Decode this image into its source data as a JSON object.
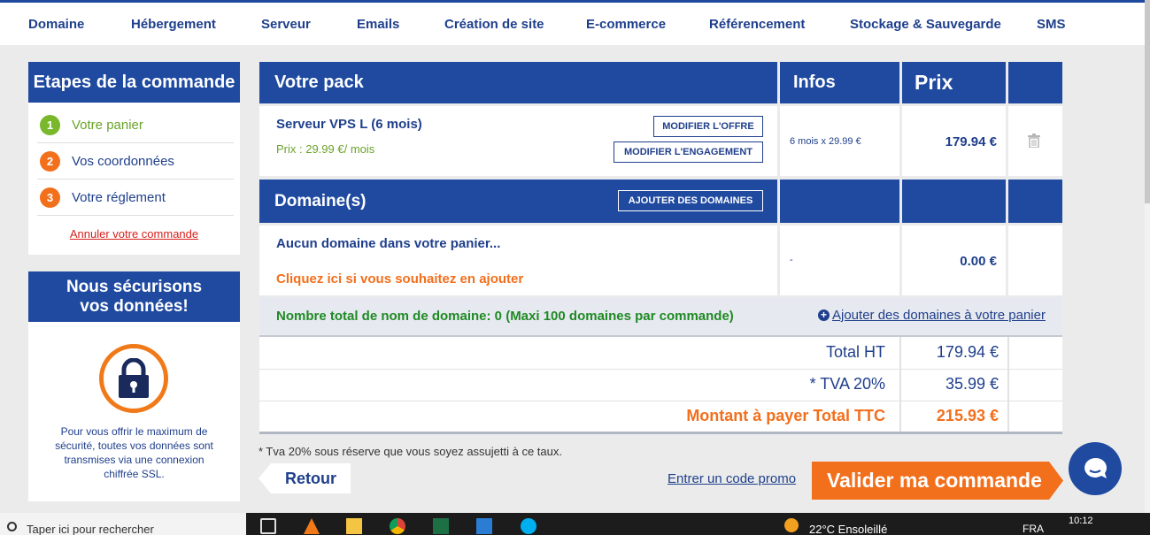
{
  "nav": [
    "Domaine",
    "Hébergement",
    "Serveur",
    "Emails",
    "Création de site",
    "E-commerce",
    "Référencement",
    "Stockage & Sauvegarde",
    "SMS"
  ],
  "steps": {
    "title": "Etapes de la commande",
    "items": [
      {
        "num": "1",
        "label": "Votre panier",
        "state": "active"
      },
      {
        "num": "2",
        "label": "Vos coordonnées",
        "state": "pending"
      },
      {
        "num": "3",
        "label": "Votre réglement",
        "state": "pending"
      }
    ],
    "cancel": "Annuler votre commande"
  },
  "secure": {
    "title_line1": "Nous sécurisons",
    "title_line2": "vos données!",
    "text": "Pour vous offrir le maximum de sécurité, toutes vos données sont transmises via une connexion chiffrée SSL."
  },
  "table": {
    "headers": {
      "pack": "Votre pack",
      "infos": "Infos",
      "prix": "Prix"
    },
    "pack_item": {
      "name": "Serveur VPS L (6 mois)",
      "price_line": "Prix : 29.99 €/ mois",
      "btn_modify_offer": "MODIFIER L'OFFRE",
      "btn_modify_commitment": "MODIFIER L'ENGAGEMENT",
      "info": "6 mois x 29.99 €",
      "price": "179.94 €"
    },
    "domains": {
      "title": "Domaine(s)",
      "btn_add": "AJOUTER DES DOMAINES",
      "empty": "Aucun domaine dans votre panier...",
      "click_here": "Cliquez ici si vous souhaitez en ajouter",
      "info": "-",
      "price": "0.00 €",
      "total_count": "Nombre total de nom de domaine: 0 (Maxi 100 domaines par commande)",
      "add_link": "Ajouter des domaines à votre panier"
    },
    "totals": {
      "ht_label": "Total HT",
      "ht_value": "179.94 €",
      "tva_label": "* TVA 20%",
      "tva_value": "35.99 €",
      "ttc_label": "Montant à payer Total TTC",
      "ttc_value": "215.93 €"
    },
    "footnote": "* Tva 20% sous réserve que vous soyez assujetti à ce taux."
  },
  "actions": {
    "back": "Retour",
    "promo": "Entrer un code promo",
    "validate": "Valider ma commande"
  },
  "taskbar": {
    "search_placeholder": "Taper ici pour rechercher",
    "weather": "22°C  Ensoleillé",
    "lang": "FRA",
    "time": "10:12"
  },
  "colors": {
    "brand_blue": "#1f4aa0",
    "orange": "#f26f1c",
    "green": "#1f8a24",
    "red": "#d6201c"
  }
}
